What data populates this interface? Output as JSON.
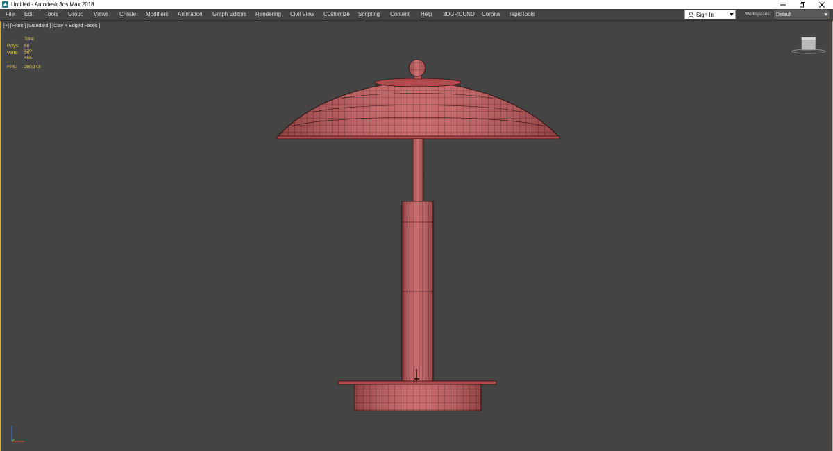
{
  "window": {
    "title": "Untitled - Autodesk 3ds Max 2018"
  },
  "menu": {
    "items": [
      {
        "first": "F",
        "rest": "ile"
      },
      {
        "first": "E",
        "rest": "dit"
      },
      {
        "first": "T",
        "rest": "ools"
      },
      {
        "first": "G",
        "rest": "roup"
      },
      {
        "first": "V",
        "rest": "iews"
      },
      {
        "first": "C",
        "rest": "reate"
      },
      {
        "first": "M",
        "rest": "odifiers"
      },
      {
        "first": "A",
        "rest": "nimation"
      },
      {
        "first": "",
        "rest": "Graph Editors"
      },
      {
        "first": "R",
        "rest": "endering"
      },
      {
        "first": "",
        "rest": "Civil View"
      },
      {
        "first": "C",
        "rest": "ustomize"
      },
      {
        "first": "S",
        "rest": "cripting"
      },
      {
        "first": "",
        "rest": "Content"
      },
      {
        "first": "H",
        "rest": "elp"
      },
      {
        "first": "",
        "rest": "3DGROUND"
      },
      {
        "first": "",
        "rest": "Corona"
      },
      {
        "first": "",
        "rest": "rapidTools"
      }
    ]
  },
  "account": {
    "signin_label": "Sign In",
    "workspaces_label": "Workspaces:",
    "workspace_value": "Default"
  },
  "viewport": {
    "label": "[+] [Front ] [Standard ] [Clay + Edged Faces ]",
    "stats": {
      "header": "Total",
      "polys_label": "Polys:",
      "polys_value": "68 320",
      "verts_label": "Verts:",
      "verts_value": "34 465",
      "fps_label": "FPS:",
      "fps_value": "280,143"
    }
  },
  "colors": {
    "viewport_bg": "#444444",
    "stats_text": "#e8d34a",
    "model_fill": "#c3585a",
    "wire": "#2a0e0e",
    "active_border": "#d3b04a"
  }
}
